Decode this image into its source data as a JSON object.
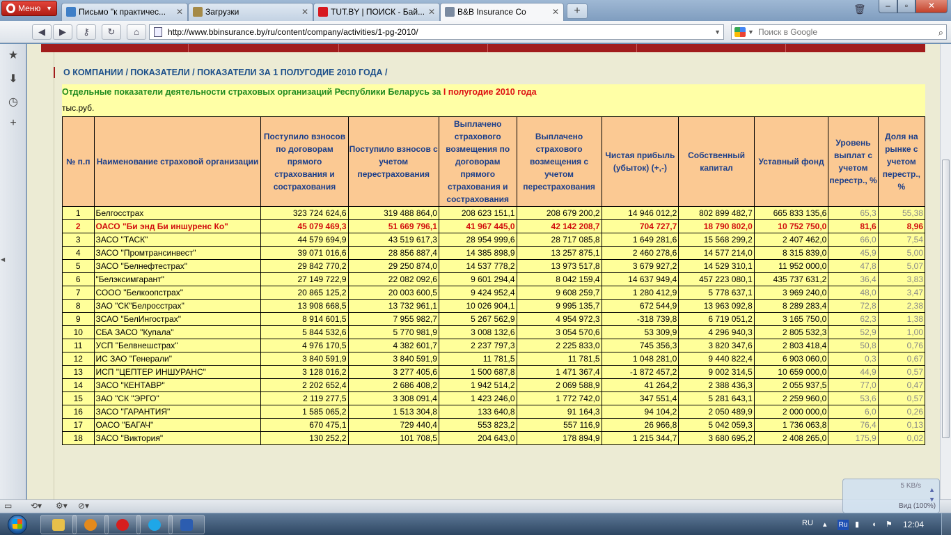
{
  "browser": {
    "menu_label": "Меню",
    "tabs": [
      {
        "label": "Письмо \"к практичес...",
        "icon": "mail-icon",
        "color": "#3f7fc7"
      },
      {
        "label": "Загрузки",
        "icon": "downloads-icon",
        "color": "#a58a47"
      },
      {
        "label": "TUT.BY | ПОИСК - Бай...",
        "icon": "tutby-icon",
        "color": "#d71920"
      },
      {
        "label": "B&B Insurance Co",
        "icon": "page-icon",
        "color": "#7a8aa0"
      }
    ],
    "url": "http://www.bbinsurance.by/ru/content/company/activities/1-pg-2010/",
    "search_placeholder": "Поиск в Google"
  },
  "page": {
    "breadcrumb": "О КОМПАНИИ / ПОКАЗАТЕЛИ / ПОКАЗАТЕЛИ ЗА 1 ПОЛУГОДИЕ 2010 ГОДА /",
    "heading_main": "Отдельные показатели деятельности страховых организаций Республики Беларусь за ",
    "heading_period": "I полугодие 2010 года",
    "units": "тыс.руб.",
    "columns": [
      "№ п.п",
      "Наименование страховой организации",
      "Поступило взносов по договорам прямого страхования и сострахования",
      "Поступило взносов с учетом перестрахования",
      "Выплачено страхового возмещения по договорам прямого страхования и сострахования",
      "Выплачено страхового возмещения с учетом перестрахования",
      "Чистая прибыль (убыток) (+,-)",
      "Собственный капитал",
      "Уставный фонд",
      "Уровень выплат с учетом перестр., %",
      "Доля на рынке с учетом перестр., %"
    ],
    "rows": [
      [
        "1",
        "Белгосстрах",
        "323 724 624,6",
        "319 488 864,0",
        "208 623 151,1",
        "208 679 200,2",
        "14 946 012,2",
        "802 899 482,7",
        "665 833 135,6",
        "65,3",
        "55,38"
      ],
      [
        "2",
        "ОАСО \"Би энд Би иншуренс Ко\"",
        "45 079 469,3",
        "51 669 796,1",
        "41 967 445,0",
        "42 142 208,7",
        "704 727,7",
        "18 790 802,0",
        "10 752 750,0",
        "81,6",
        "8,96"
      ],
      [
        "3",
        "ЗАСО \"ТАСК\"",
        "44 579 694,9",
        "43 519 617,3",
        "28 954 999,6",
        "28 717 085,8",
        "1 649 281,6",
        "15 568 299,2",
        "2 407 462,0",
        "66,0",
        "7,54"
      ],
      [
        "4",
        "ЗАСО \"Промтрансинвест\"",
        "39 071 016,6",
        "28 856 887,4",
        "14 385 898,9",
        "13 257 875,1",
        "2 460 278,6",
        "14 577 214,0",
        "8 315 839,0",
        "45,9",
        "5,00"
      ],
      [
        "5",
        "ЗАСО \"Белнефтестрах\"",
        "29 842 770,2",
        "29 250 874,0",
        "14 537 778,2",
        "13 973 517,8",
        "3 679 927,2",
        "14 529 310,1",
        "11 952 000,0",
        "47,8",
        "5,07"
      ],
      [
        "6",
        "\"Белэксимгарант\"",
        "27 149 722,9",
        "22 082 092,6",
        "9 601 294,4",
        "8 042 159,4",
        "14 637 949,4",
        "457 223 080,1",
        "435 737 631,2",
        "36,4",
        "3,83"
      ],
      [
        "7",
        "СООО \"Белкоопстрах\"",
        "20 865 125,2",
        "20 003 600,5",
        "9 424 952,4",
        "9 608 259,7",
        "1 280 412,9",
        "5 778 637,1",
        "3 969 240,0",
        "48,0",
        "3,47"
      ],
      [
        "8",
        "ЗАО \"СК\"Белросстрах\"",
        "13 908 668,5",
        "13 732 961,1",
        "10 026 904,1",
        "9 995 135,7",
        "672 544,9",
        "13 963 092,8",
        "8 289 283,4",
        "72,8",
        "2,38"
      ],
      [
        "9",
        "ЗСАО \"БелИнгострах\"",
        "8 914 601,5",
        "7 955 982,7",
        "5 267 562,9",
        "4 954 972,3",
        "-318 739,8",
        "6 719 051,2",
        "3 165 750,0",
        "62,3",
        "1,38"
      ],
      [
        "10",
        "СБА ЗАСО \"Купала\"",
        "5 844 532,6",
        "5 770 981,9",
        "3 008 132,6",
        "3 054 570,6",
        "53 309,9",
        "4 296 940,3",
        "2 805 532,3",
        "52,9",
        "1,00"
      ],
      [
        "11",
        "УСП \"Белвнешстрах\"",
        "4 976 170,5",
        "4 382 601,7",
        "2 237 797,3",
        "2 225 833,0",
        "745 356,3",
        "3 820 347,6",
        "2 803 418,4",
        "50,8",
        "0,76"
      ],
      [
        "12",
        "ИС ЗАО \"Генерали\"",
        "3 840 591,9",
        "3 840 591,9",
        "11 781,5",
        "11 781,5",
        "1 048 281,0",
        "9 440 822,4",
        "6 903 060,0",
        "0,3",
        "0,67"
      ],
      [
        "13",
        "ИСП \"ЦЕПТЕР ИНШУРАНС\"",
        "3 128 016,2",
        "3 277 405,6",
        "1 500 687,8",
        "1 471 367,4",
        "-1 872 457,2",
        "9 002 314,5",
        "10 659 000,0",
        "44,9",
        "0,57"
      ],
      [
        "14",
        "ЗАСО \"КЕНТАВР\"",
        "2 202 652,4",
        "2 686 408,2",
        "1 942 514,2",
        "2 069 588,9",
        "41 264,2",
        "2 388 436,3",
        "2 055 937,5",
        "77,0",
        "0,47"
      ],
      [
        "15",
        "ЗАО \"СК \"ЭРГО\"",
        "2 119 277,5",
        "3 308 091,4",
        "1 423 246,0",
        "1 772 742,0",
        "347 551,4",
        "5 281 643,1",
        "2 259 960,0",
        "53,6",
        "0,57"
      ],
      [
        "16",
        "ЗАСО \"ГАРАНТИЯ\"",
        "1 585 065,2",
        "1 513 304,8",
        "133 640,8",
        "91 164,3",
        "94 104,2",
        "2 050 489,9",
        "2 000 000,0",
        "6,0",
        "0,26"
      ],
      [
        "17",
        "ОАСО \"БАГАЧ\"",
        "670 475,1",
        "729 440,4",
        "553 823,2",
        "557 116,9",
        "26 966,8",
        "5 042 059,3",
        "1 736 063,8",
        "76,4",
        "0,13"
      ],
      [
        "18",
        "ЗАСО \"Виктория\"",
        "130 252,2",
        "101 708,5",
        "204 643,0",
        "178 894,9",
        "1 215 344,7",
        "3 680 695,2",
        "2 408 265,0",
        "175,9",
        "0,02"
      ]
    ],
    "highlight_row": 1
  },
  "status": {
    "download_speed": "5 KB/s",
    "zoom": "Вид (100%)"
  },
  "taskbar": {
    "lang": "RU",
    "input_badge": "Ru",
    "clock": "12:04",
    "apps": [
      {
        "icon": "explorer-icon",
        "color": "#e8c04a"
      },
      {
        "icon": "winamp-icon",
        "color": "#e58a1c"
      },
      {
        "icon": "opera-icon",
        "color": "#d61e1e"
      },
      {
        "icon": "skype-icon",
        "color": "#1ea7e8"
      },
      {
        "icon": "word-icon",
        "color": "#2c5db0"
      }
    ]
  }
}
